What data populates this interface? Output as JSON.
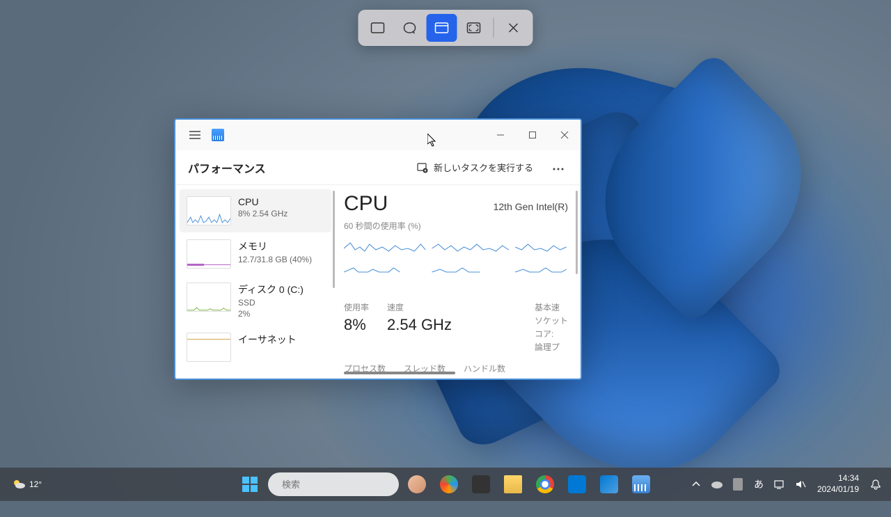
{
  "snip": {
    "modes": [
      "rect",
      "freeform",
      "window",
      "fullscreen"
    ],
    "active_index": 2
  },
  "task_manager": {
    "header_title": "パフォーマンス",
    "new_task_label": "新しいタスクを実行する",
    "sidebar": [
      {
        "name": "CPU",
        "sub": "8%  2.54 GHz"
      },
      {
        "name": "メモリ",
        "sub": "12.7/31.8 GB (40%)"
      },
      {
        "name": "ディスク 0 (C:)",
        "sub": "SSD",
        "sub2": "2%"
      },
      {
        "name": "イーサネット",
        "sub": ""
      }
    ],
    "main": {
      "title": "CPU",
      "subtitle": "12th Gen Intel(R)",
      "chart_label": "60 秒間の使用率 (%)",
      "stats": {
        "usage_label": "使用率",
        "usage_value": "8%",
        "speed_label": "速度",
        "speed_value": "2.54 GHz",
        "base_label": "基本速",
        "sockets_label": "ソケット",
        "cores_label": "コア:",
        "logical_label": "論理プ",
        "proc_label": "プロセス数",
        "thread_label": "スレッド数",
        "handle_label": "ハンドル数"
      }
    }
  },
  "taskbar": {
    "weather_temp": "12°",
    "search_placeholder": "検索",
    "ime": "あ",
    "time": "14:34",
    "date": "2024/01/19"
  }
}
